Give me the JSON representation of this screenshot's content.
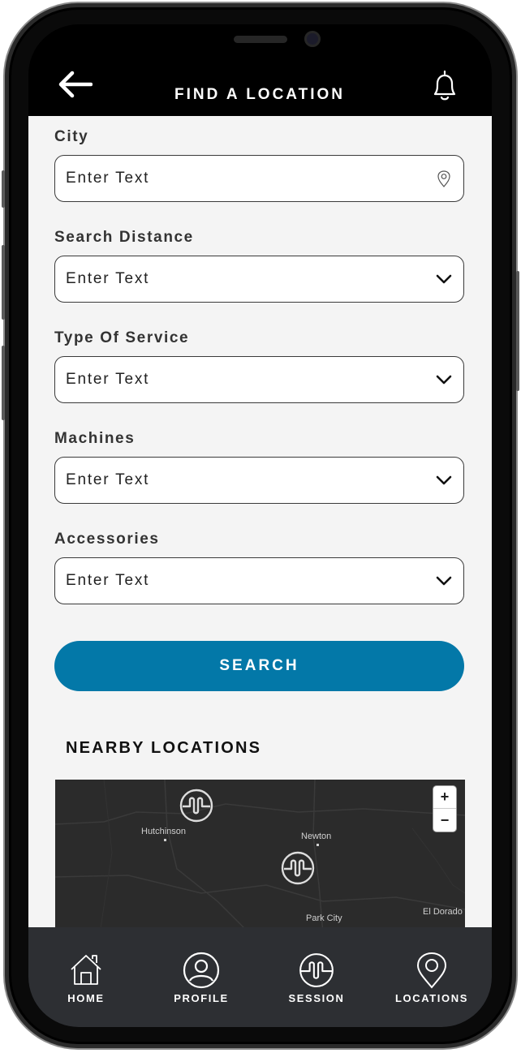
{
  "header": {
    "title": "FIND A LOCATION"
  },
  "form": {
    "fields": [
      {
        "label": "City",
        "placeholder": "Enter Text",
        "suffix": "location-pin-icon"
      },
      {
        "label": "Search Distance",
        "placeholder": "Enter Text",
        "suffix": "chevron-down-icon"
      },
      {
        "label": "Type Of Service",
        "placeholder": "Enter Text",
        "suffix": "chevron-down-icon"
      },
      {
        "label": "Machines",
        "placeholder": "Enter Text",
        "suffix": "chevron-down-icon"
      },
      {
        "label": "Accessories",
        "placeholder": "Enter Text",
        "suffix": "chevron-down-icon"
      }
    ],
    "search_label": "SEARCH"
  },
  "nearby": {
    "title": "NEARBY LOCATIONS",
    "map": {
      "places": [
        "Hutchinson",
        "Newton",
        "Park City",
        "El Dorado"
      ],
      "zoom_in": "+",
      "zoom_out": "−"
    }
  },
  "nav": {
    "items": [
      {
        "label": "HOME",
        "icon": "home-icon"
      },
      {
        "label": "PROFILE",
        "icon": "profile-icon"
      },
      {
        "label": "SESSION",
        "icon": "session-icon"
      },
      {
        "label": "LOCATIONS",
        "icon": "location-pin-icon"
      }
    ]
  },
  "colors": {
    "accent": "#0378a8",
    "nav_bg": "#2d2f33",
    "content_bg": "#f4f4f4"
  }
}
